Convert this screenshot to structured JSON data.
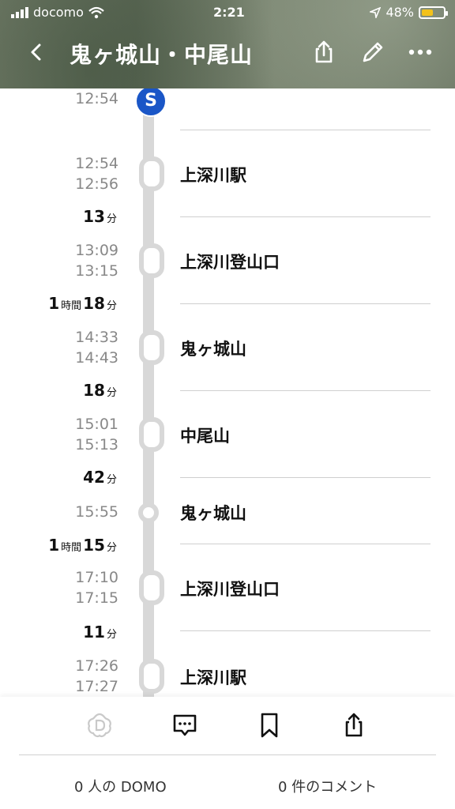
{
  "status": {
    "carrier": "docomo",
    "time": "2:21",
    "battery": "48%",
    "battery_level": 0.48
  },
  "nav": {
    "title": "鬼ヶ城山・中尾山",
    "icons": [
      "back-icon",
      "share-icon",
      "edit-icon",
      "more-icon"
    ]
  },
  "timeline": {
    "start": {
      "time": "12:54",
      "badge": "S"
    },
    "stops": [
      {
        "arrive": "12:54",
        "depart": "12:56",
        "name": "上深川駅"
      },
      {
        "arrive": "13:09",
        "depart": "13:15",
        "name": "上深川登山口"
      },
      {
        "arrive": "14:33",
        "depart": "14:43",
        "name": "鬼ヶ城山"
      },
      {
        "arrive": "15:01",
        "depart": "15:13",
        "name": "中尾山"
      },
      {
        "arrive": "15:55",
        "name": "鬼ヶ城山"
      },
      {
        "arrive": "17:10",
        "depart": "17:15",
        "name": "上深川登山口"
      },
      {
        "arrive": "17:26",
        "depart": "17:27",
        "name": "上深川駅"
      }
    ],
    "durations": [
      {
        "num1": "13",
        "unit1": "分"
      },
      {
        "hours": "1",
        "hunit": "時間",
        "num1": "18",
        "unit1": "分"
      },
      {
        "num1": "18",
        "unit1": "分"
      },
      {
        "num1": "42",
        "unit1": "分"
      },
      {
        "hours": "1",
        "hunit": "時間",
        "num1": "15",
        "unit1": "分"
      },
      {
        "num1": "11",
        "unit1": "分"
      }
    ]
  },
  "bottom": {
    "domo": "0 人の DOMO",
    "comments": "0 件のコメント"
  }
}
